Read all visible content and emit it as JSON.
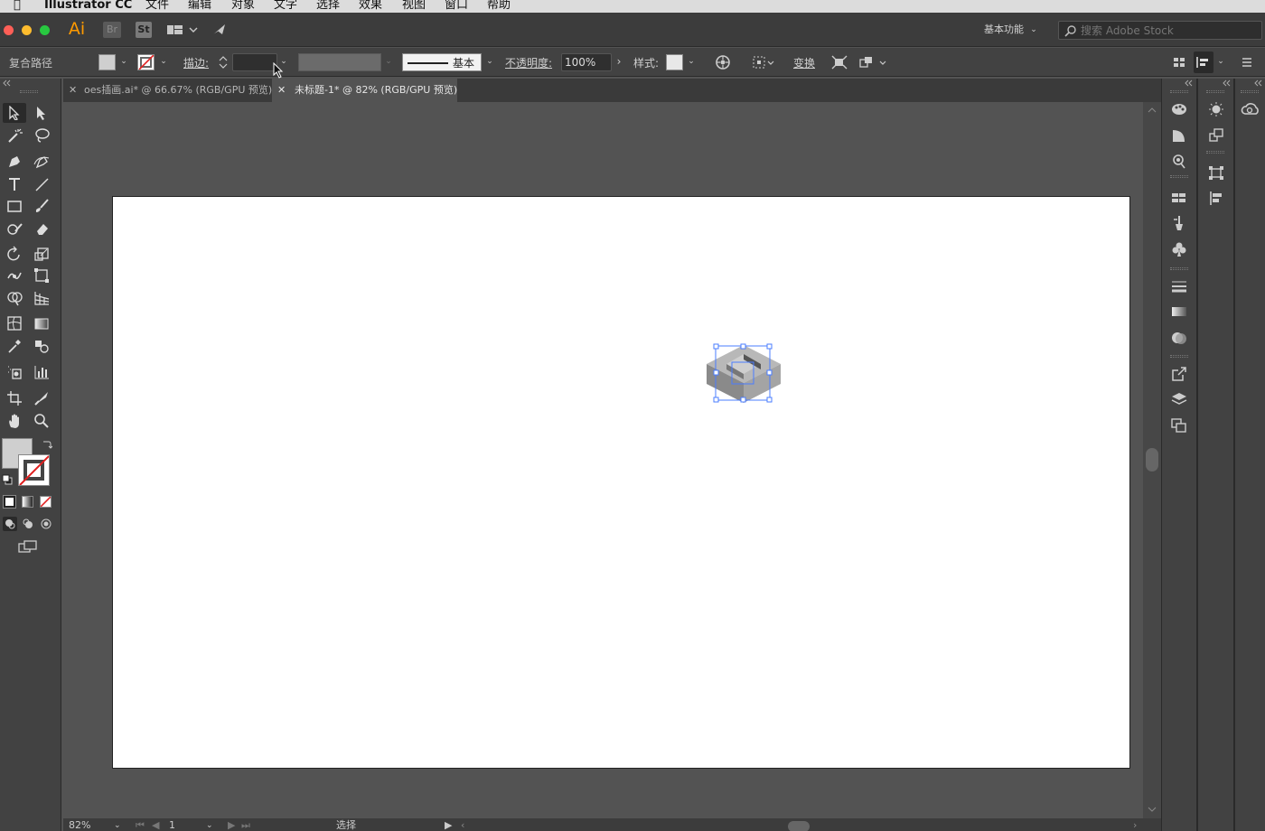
{
  "menubar": {
    "app_name": "Illustrator CC",
    "items": [
      "文件",
      "编辑",
      "对象",
      "文字",
      "选择",
      "效果",
      "视图",
      "窗口",
      "帮助"
    ]
  },
  "appbar": {
    "logo": "Ai",
    "bridge": "Br",
    "stock": "St",
    "workspace_label": "基本功能",
    "search_placeholder": "搜索 Adobe Stock"
  },
  "control_bar": {
    "selection_type": "复合路径",
    "stroke_label": "描边:",
    "stroke_weight": "",
    "stroke_profile": "基本",
    "opacity_label": "不透明度:",
    "opacity_value": "100%",
    "style_label": "样式:",
    "transform_label": "变换"
  },
  "tabs": [
    {
      "label": "oes插画.ai* @ 66.67% (RGB/GPU 预览)",
      "active": false
    },
    {
      "label": "未标题-1* @ 82% (RGB/GPU 预览)",
      "active": true
    }
  ],
  "status_bar": {
    "zoom": "82%",
    "page": "1",
    "tool_status": "选择"
  },
  "colors": {
    "fill": "#cfcfcf",
    "stroke": "none",
    "selection": "#4a7cff",
    "close_button": "#fe5f57",
    "minimize_button": "#febc2e",
    "maximize_button": "#28c840",
    "ai_logo": "#ff9a00"
  }
}
